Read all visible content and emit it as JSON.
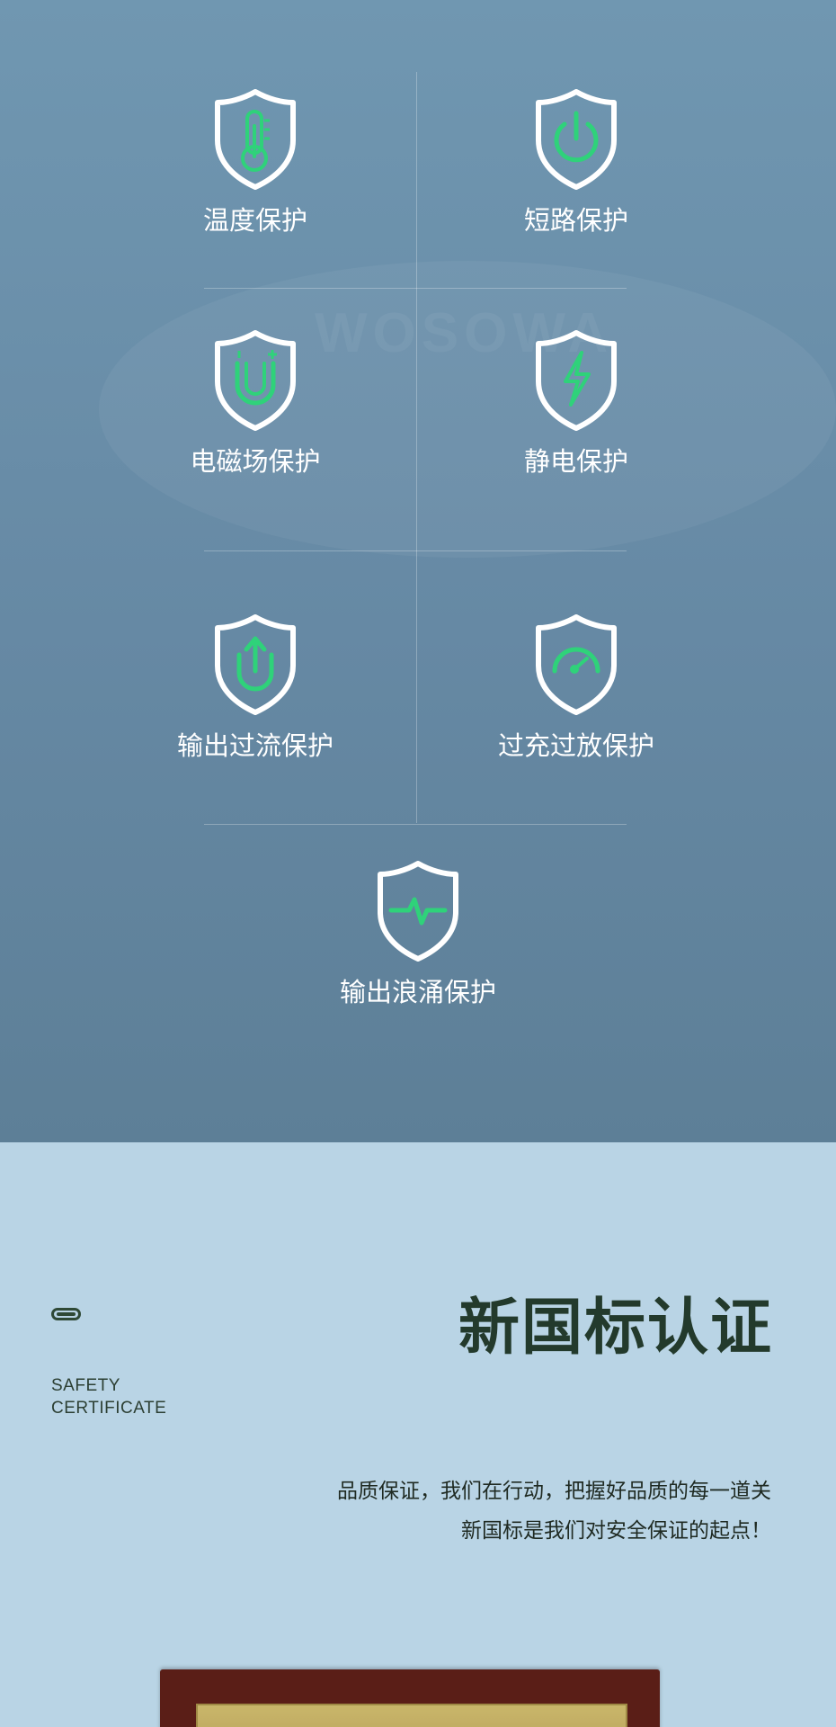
{
  "features": [
    {
      "icon": "thermometer-icon",
      "label": "温度保护"
    },
    {
      "icon": "power-icon",
      "label": "短路保护"
    },
    {
      "icon": "magnet-icon",
      "label": "电磁场保护"
    },
    {
      "icon": "lightning-icon",
      "label": "静电保护"
    },
    {
      "icon": "upload-arrow-icon",
      "label": "输出过流保护"
    },
    {
      "icon": "gauge-icon",
      "label": "过充过放保护"
    },
    {
      "icon": "pulse-icon",
      "label": "输出浪涌保护"
    }
  ],
  "certificate": {
    "title": "新国标认证",
    "subtitle_line1": "SAFETY",
    "subtitle_line2": "CERTIFICATE",
    "desc_line1": "品质保证，我们在行动，把握好品质的每一道关",
    "desc_line2": "新国标是我们对安全保证的起点！"
  },
  "colors": {
    "accent_green": "#2fd27a",
    "top_background": "#6a8fa9",
    "bottom_background": "#b9d4e5",
    "title_color": "#233a2c"
  }
}
